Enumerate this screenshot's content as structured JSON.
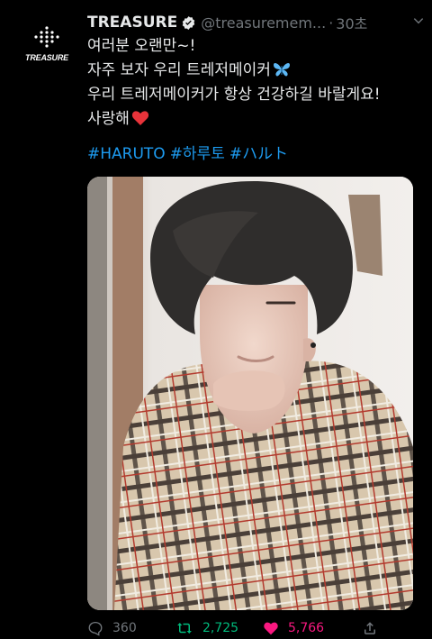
{
  "account": {
    "avatar_brand": "TREASURE",
    "display_name": "TREASURE",
    "handle": "@treasuremem...",
    "separator": "·",
    "time": "30초"
  },
  "tweet": {
    "lines": [
      "여러분 오랜만~!",
      "자주 보자 우리 트레저메이커",
      "우리 트레저메이커가 항상 건강하길 바랄게요!",
      "사랑해"
    ],
    "hashtags": [
      "#HARUTO",
      "#하루토",
      "#ハルト"
    ]
  },
  "actions": {
    "replies": "360",
    "retweets": "2,725",
    "likes": "5,766"
  },
  "icons": {
    "verified": "verified-badge-icon",
    "caret": "chevron-down-icon",
    "reply": "reply-icon",
    "retweet": "retweet-icon",
    "like": "heart-icon",
    "share": "share-icon"
  },
  "colors": {
    "background": "#000000",
    "text": "#e7e9ea",
    "muted": "#71767b",
    "link": "#1d9bf0",
    "retweet_active": "#00ba7c",
    "like_active": "#f91880"
  }
}
